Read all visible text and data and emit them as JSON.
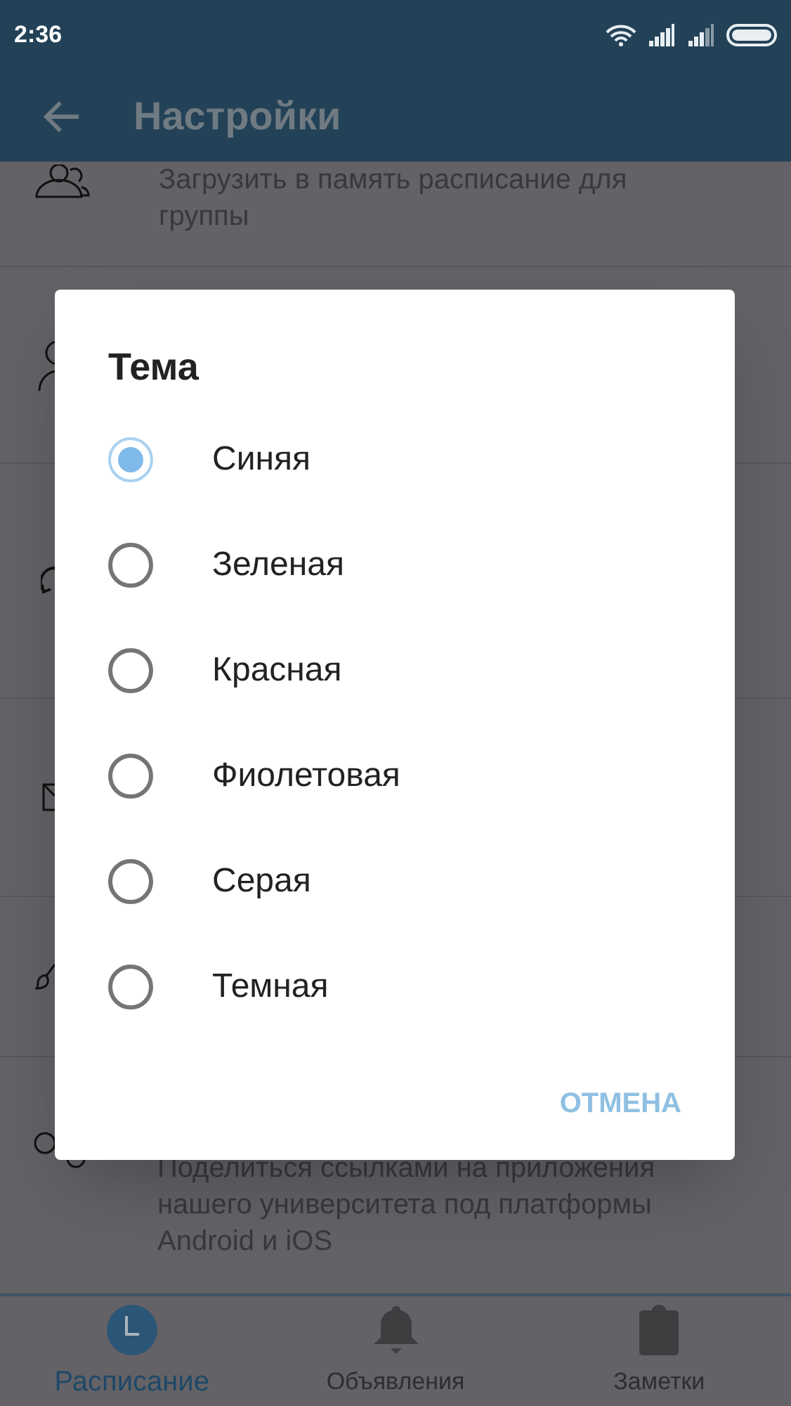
{
  "status_bar": {
    "time": "2:36"
  },
  "app_bar": {
    "title": "Настройки"
  },
  "settings": [
    {
      "text": "Загрузить в память расписание для группы"
    },
    {
      "text": "Поделиться ссылками на приложения нашего университета под платформы Android и iOS"
    }
  ],
  "dialog": {
    "title": "Тема",
    "options": [
      {
        "label": "Синяя",
        "selected": true
      },
      {
        "label": "Зеленая",
        "selected": false
      },
      {
        "label": "Красная",
        "selected": false
      },
      {
        "label": "Фиолетовая",
        "selected": false
      },
      {
        "label": "Серая",
        "selected": false
      },
      {
        "label": "Темная",
        "selected": false
      }
    ],
    "cancel": "ОТМЕНА"
  },
  "bottom_nav": [
    {
      "label": "Расписание",
      "selected": true
    },
    {
      "label": "Объявления",
      "selected": false
    },
    {
      "label": "Заметки",
      "selected": false
    }
  ]
}
